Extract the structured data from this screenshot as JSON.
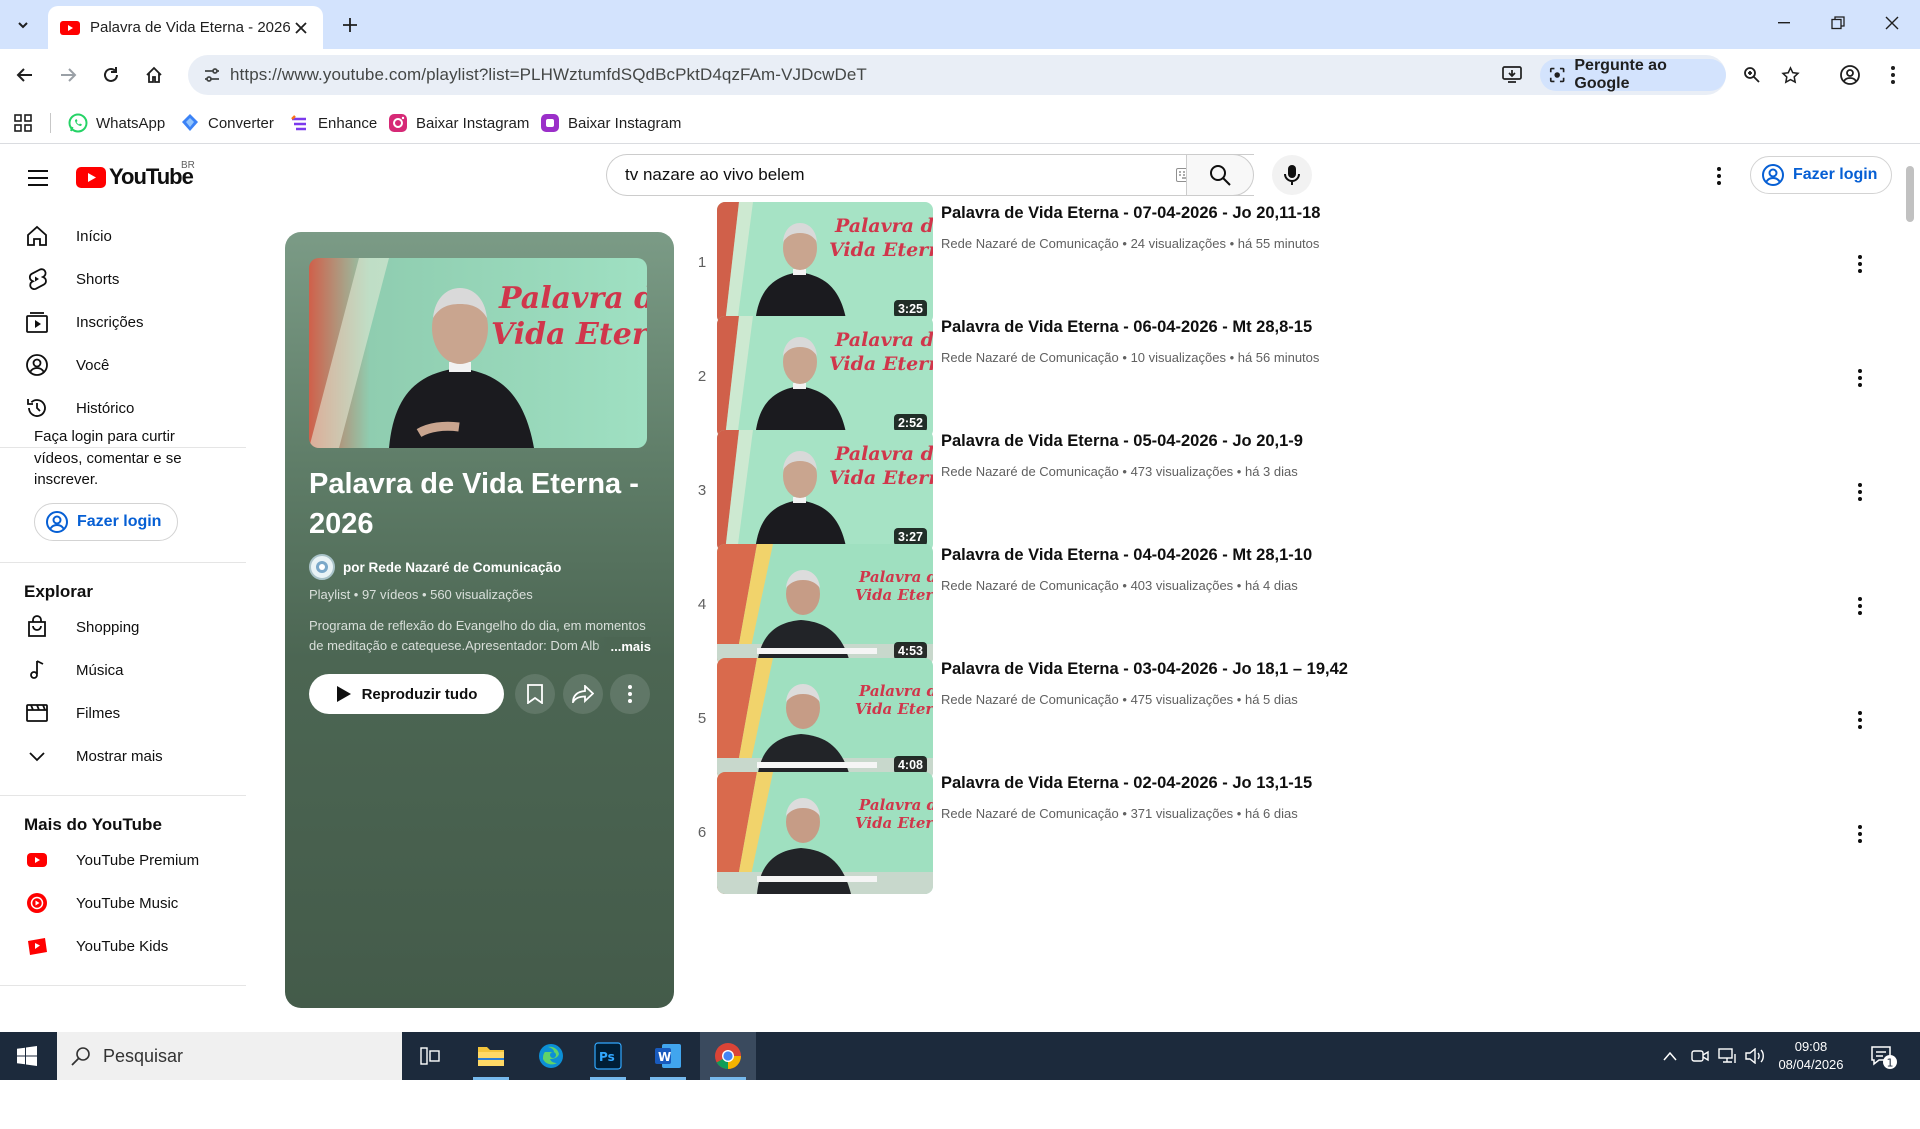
{
  "browser": {
    "tab_title": "Palavra de Vida Eterna - 2026 -",
    "url": "https://www.youtube.com/playlist?list=PLHWztumfdSQdBcPktD4qzFAm-VJDcwDeT",
    "ask_google": "Pergunte ao Google",
    "bookmarks": [
      "WhatsApp",
      "Converter",
      "Enhance",
      "Baixar Instagram",
      "Baixar Instagram"
    ]
  },
  "masthead": {
    "logo_text": "YouTube",
    "region": "BR",
    "search_value": "tv nazare ao vivo belem",
    "sign_in": "Fazer login"
  },
  "sidebar": {
    "main": [
      {
        "label": "Início",
        "icon": "home-icon"
      },
      {
        "label": "Shorts",
        "icon": "shorts-icon"
      },
      {
        "label": "Inscrições",
        "icon": "subscriptions-icon"
      },
      {
        "label": "Você",
        "icon": "you-icon"
      },
      {
        "label": "Histórico",
        "icon": "history-icon"
      }
    ],
    "login_prompt": "Faça login para curtir vídeos, comentar e se inscrever.",
    "login_button": "Fazer login",
    "explore_heading": "Explorar",
    "explore": [
      {
        "label": "Shopping",
        "icon": "shopping-bag-icon"
      },
      {
        "label": "Música",
        "icon": "music-note-icon"
      },
      {
        "label": "Filmes",
        "icon": "film-icon"
      },
      {
        "label": "Mostrar mais",
        "icon": "chevron-down-icon"
      }
    ],
    "more_heading": "Mais do YouTube",
    "more": [
      {
        "label": "YouTube Premium",
        "icon": "youtube-premium-icon"
      },
      {
        "label": "YouTube Music",
        "icon": "youtube-music-icon"
      },
      {
        "label": "YouTube Kids",
        "icon": "youtube-kids-icon"
      }
    ]
  },
  "playlist": {
    "title": "Palavra de Vida Eterna - 2026",
    "owner": "por Rede Nazaré de Comunicação",
    "meta": "Playlist • 97 vídeos • 560 visualizações",
    "description": "Programa de reflexão do Evangelho do dia, em momentos de meditação e catequese.Apresentador: Dom Alb",
    "more": "...mais",
    "play_all": "Reproduzir tudo",
    "thumb_text": [
      "Palavra de",
      "Vida Eterna"
    ]
  },
  "videos": [
    {
      "index": "1",
      "title": "Palavra de Vida Eterna - 07-04-2026 - Jo 20,11-18",
      "channel": "Rede Nazaré de Comunicação",
      "views": "24 visualizações",
      "age": "há 55 minutos",
      "duration": "3:25",
      "style": "studio"
    },
    {
      "index": "2",
      "title": "Palavra de Vida Eterna - 06-04-2026 - Mt 28,8-15",
      "channel": "Rede Nazaré de Comunicação",
      "views": "10 visualizações",
      "age": "há 56 minutos",
      "duration": "2:52",
      "style": "studio"
    },
    {
      "index": "3",
      "title": "Palavra de Vida Eterna - 05-04-2026 - Jo 20,1-9",
      "channel": "Rede Nazaré de Comunicação",
      "views": "473 visualizações",
      "age": "há 3 dias",
      "duration": "3:27",
      "style": "studio"
    },
    {
      "index": "4",
      "title": "Palavra de Vida Eterna - 04-04-2026 - Mt 28,1-10",
      "channel": "Rede Nazaré de Comunicação",
      "views": "403 visualizações",
      "age": "há 4 dias",
      "duration": "4:53",
      "style": "desk"
    },
    {
      "index": "5",
      "title": "Palavra de Vida Eterna - 03-04-2026 - Jo 18,1 – 19,42",
      "channel": "Rede Nazaré de Comunicação",
      "views": "475 visualizações",
      "age": "há 5 dias",
      "duration": "4:08",
      "style": "desk"
    },
    {
      "index": "6",
      "title": "Palavra de Vida Eterna - 02-04-2026 - Jo 13,1-15",
      "channel": "Rede Nazaré de Comunicação",
      "views": "371 visualizações",
      "age": "há 6 dias",
      "duration": "",
      "style": "desk"
    }
  ],
  "taskbar": {
    "search_placeholder": "Pesquisar",
    "time": "09:08",
    "date": "08/04/2026",
    "notification_count": "1"
  },
  "colors": {
    "youtube_red": "#ff0000",
    "link_blue": "#065fd4",
    "chrome_tab_strip": "#d3e3fd",
    "playlist_panel": "#4c6653",
    "taskbar": "#1c2a3c"
  }
}
